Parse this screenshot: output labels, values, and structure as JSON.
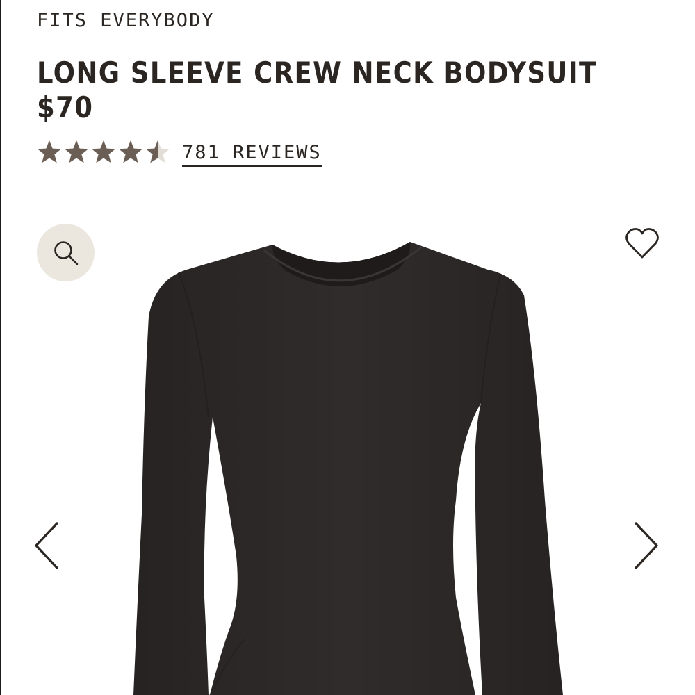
{
  "product": {
    "collection": "FITS EVERYBODY",
    "title": "LONG SLEEVE CREW NECK BODYSUIT",
    "price": "$70",
    "rating": 4.5,
    "rating_max": 5,
    "reviews_label": "781 REVIEWS"
  },
  "colors": {
    "text": "#2b2622",
    "star": "#6b5e55",
    "star_empty": "#e2ddd6",
    "zoom_bg": "#ebe6de",
    "garment": "#2c2928"
  },
  "icons": {
    "zoom": "magnifier-icon",
    "wishlist": "heart-outline-icon",
    "prev": "chevron-left-icon",
    "next": "chevron-right-icon",
    "star": "star-icon"
  }
}
